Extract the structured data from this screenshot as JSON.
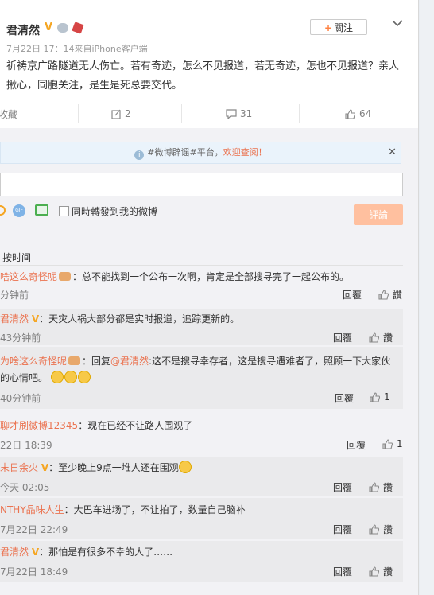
{
  "post": {
    "author": "君清然",
    "meta": "7月22日 17：14来自iPhone客户端",
    "content": "祈祷京广路隧道无人伤亡。若有奇迹，怎么不见报道，若无奇迹，怎也不见报道？亲人揪心，同胞关注，是生是死总要交代。",
    "follow_label": "關注"
  },
  "actions": {
    "favorite": "收藏",
    "repost": "2",
    "comment": "31",
    "like": "64"
  },
  "notice": {
    "tag": "#微博辟谣#平台，",
    "link": "欢迎查阅！"
  },
  "composer": {
    "repost_checkbox_label": "同時轉發到我的微博",
    "submit_label": "評論"
  },
  "sort_label": "按时间",
  "reply_label": "回覆",
  "like_label": "讚",
  "comments": [
    {
      "user": "啥这么奇怪呢",
      "text": "：总不能找到一个公布一次啊，肯定是全部搜寻完了一起公布的。",
      "time": "分钟前",
      "likes": "讚"
    },
    {
      "user": "君清然",
      "text": "：天灾人祸大部分都是实时报道，追踪更新的。",
      "time": "43分钟前",
      "likes": "讚"
    },
    {
      "user": "为啥这么奇怪呢",
      "reply_prefix": "：回复",
      "mention": "@君清然",
      "text": ":这不是搜寻幸存者，这是搜寻遇难者了，照顾一下大家伙的心情吧。",
      "time": "40分钟前",
      "likes": "1"
    },
    {
      "user": "聊才刷微博12345",
      "text": "：现在已经不让路人围观了",
      "time": "22日 18:39",
      "likes": "1"
    },
    {
      "user": "末日余火",
      "text": "：至少晚上9点一堆人还在围观",
      "time": "今天 02:05",
      "likes": "讚"
    },
    {
      "user": "NTHY品味人生",
      "text": "：大巴车进场了，不让拍了，数量自己脑补",
      "time": "7月22日 22:49",
      "likes": "讚"
    },
    {
      "user": "君清然",
      "text": "：那怕是有很多不幸的人了……",
      "time": "7月22日 18:49",
      "likes": "讚"
    }
  ]
}
